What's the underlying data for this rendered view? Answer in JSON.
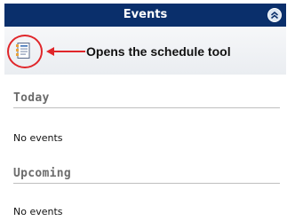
{
  "header": {
    "title": "Events",
    "collapse_icon": "chevron-double-up-icon"
  },
  "toolbar": {
    "schedule_tool_icon": "calendar-list-icon",
    "annotation_text": "Opens the schedule tool",
    "highlight_color": "#e0262a"
  },
  "sections": [
    {
      "title": "Today",
      "empty_text": "No events"
    },
    {
      "title": "Upcoming",
      "empty_text": "No events"
    }
  ],
  "colors": {
    "header_bg": "#0a2f6b",
    "header_text": "#ffffff",
    "section_title": "#6b6b6b"
  }
}
